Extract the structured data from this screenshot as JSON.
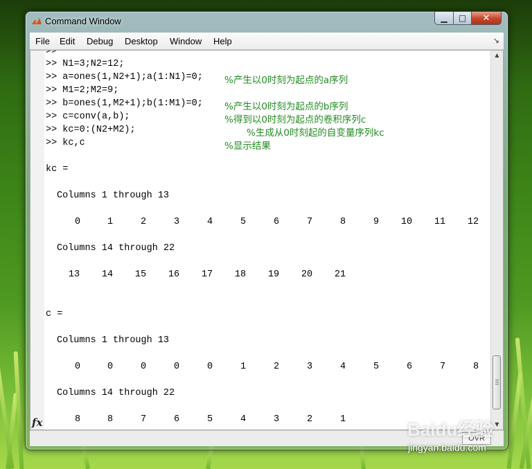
{
  "window": {
    "title": "Command Window",
    "app_icon": "matlab-logo-icon"
  },
  "controls": {
    "minimize": "▁",
    "maximize": "□",
    "close": "✕"
  },
  "menu": {
    "items": [
      "File",
      "Edit",
      "Debug",
      "Desktop",
      "Window",
      "Help"
    ],
    "corner_icon": "↘"
  },
  "command_lines": [
    {
      "code": ">>",
      "comment": ""
    },
    {
      "code": ">> N1=3;N2=12;",
      "comment": ""
    },
    {
      "code": ">> a=ones(1,N2+1);a(1:N1)=0;",
      "comment": "%产生以0时刻为起点的a序列"
    },
    {
      "code": ">> M1=2;M2=9;",
      "comment": ""
    },
    {
      "code": ">> b=ones(1,M2+1);b(1:M1)=0;",
      "comment": "%产生以0时刻为起点的b序列"
    },
    {
      "code": ">> c=conv(a,b);",
      "comment": "%得到以0时刻为起点的卷积序列c"
    },
    {
      "code": ">> kc=0:(N2+M2);",
      "comment": "%生成从0时刻起的自变量序列kc"
    },
    {
      "code": ">> kc,c",
      "comment": "%显示结果"
    }
  ],
  "output": {
    "kc_label": "kc =",
    "c_label": "c =",
    "cols_1_13": "Columns 1 through 13",
    "cols_14_22": "Columns 14 through 22",
    "kc_row1": [
      "0",
      "1",
      "2",
      "3",
      "4",
      "5",
      "6",
      "7",
      "8",
      "9",
      "10",
      "11",
      "12"
    ],
    "kc_row2": [
      "13",
      "14",
      "15",
      "16",
      "17",
      "18",
      "19",
      "20",
      "21"
    ],
    "c_row1": [
      "0",
      "0",
      "0",
      "0",
      "0",
      "1",
      "2",
      "3",
      "4",
      "5",
      "6",
      "7",
      "8"
    ],
    "c_row2": [
      "8",
      "8",
      "7",
      "6",
      "5",
      "4",
      "3",
      "2",
      "1"
    ]
  },
  "fx_label": "fx",
  "status": {
    "ovr": "OVR"
  },
  "scroll": {
    "up_icon": "▲",
    "down_icon": "▼"
  },
  "watermark": {
    "logo_text": "Baidu经验",
    "url": "jingyan.baidu.com"
  }
}
